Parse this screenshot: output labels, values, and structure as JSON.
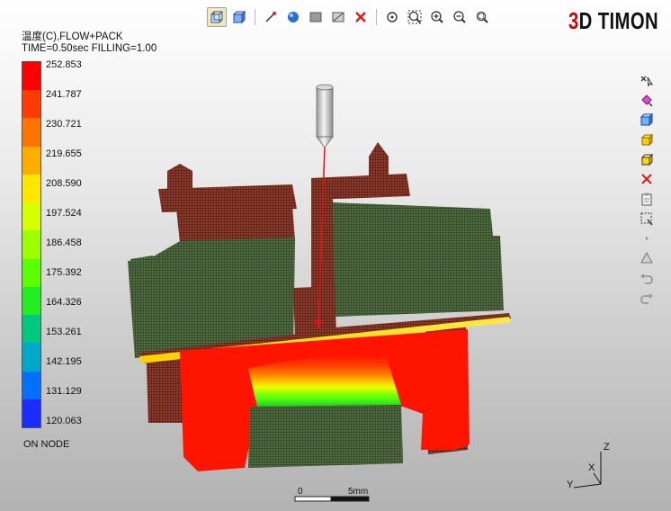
{
  "header": {
    "title": "温度(C),FLOW+PACK",
    "status": "TIME=0.50sec FILLING=1.00"
  },
  "logo": {
    "accent": "3",
    "rest": "D TIMON"
  },
  "legend": {
    "values": [
      "252.853",
      "241.787",
      "230.721",
      "219.655",
      "208.590",
      "197.524",
      "186.458",
      "175.392",
      "164.326",
      "153.261",
      "142.195",
      "131.129",
      "120.063"
    ],
    "colors": [
      "#ff0000",
      "#ff3a00",
      "#ff7400",
      "#ffae00",
      "#ffe600",
      "#d8ff00",
      "#9cff00",
      "#5cff00",
      "#22ee22",
      "#00c880",
      "#00a8c8",
      "#0070ff",
      "#1c2cff"
    ],
    "footer": "ON NODE"
  },
  "toolbar": {
    "icons": [
      "mesh-view-icon",
      "solid-view-icon",
      "probe-tool-icon",
      "sphere-render-icon",
      "grid-plane-icon",
      "clip-box-icon",
      "delete-icon",
      "rotate-icon",
      "zoom-fit-icon",
      "zoom-in-icon",
      "zoom-out-icon",
      "zoom-window-icon"
    ]
  },
  "sidebar": {
    "icons": [
      "pointer-x-icon",
      "pick-color-icon",
      "cube-blue-icon",
      "cube-yellow-icon",
      "cube-yellow-outline-icon",
      "close-x-icon",
      "clipboard-icon",
      "select-grid-icon",
      "mini-arrow-icon",
      "cone-icon",
      "undo-icon",
      "redo-icon"
    ]
  },
  "scale": {
    "start": "0",
    "end": "5mm"
  },
  "triad": {
    "z": "Z",
    "x": "X",
    "y": "Y"
  },
  "colors": {
    "mesh_green": "#4e6a3e",
    "mesh_red": "#8a2e1e",
    "hot": "#ff1a00",
    "injector": "#d0d0d0",
    "flow_line": "#e81010"
  }
}
